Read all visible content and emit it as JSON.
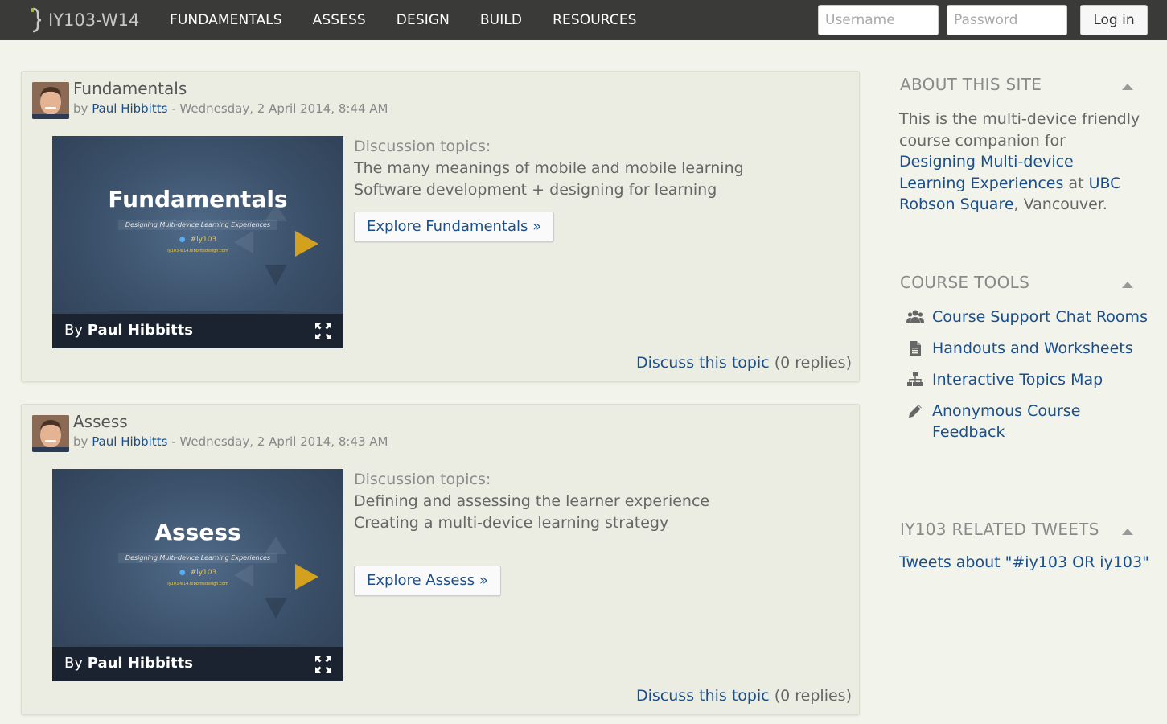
{
  "header": {
    "brand": "IY103-W14",
    "nav": [
      "FUNDAMENTALS",
      "ASSESS",
      "DESIGN",
      "BUILD",
      "RESOURCES"
    ],
    "username_placeholder": "Username",
    "password_placeholder": "Password",
    "login_label": "Log in"
  },
  "posts": [
    {
      "title": "Fundamentals",
      "by": "by",
      "author": "Paul Hibbitts",
      "date": " - Wednesday, 2 April 2014, 8:44 AM",
      "video": {
        "title": "Fundamentals",
        "subtitle": "Designing Multi-device Learning Experiences",
        "hashtag": "#iy103",
        "url": "iy103-w14.hibbittsdesign.com",
        "by_prefix": "By ",
        "by_name": "Paul Hibbitts"
      },
      "topics_label": "Discussion topics:",
      "topics": [
        "The many meanings of mobile and mobile learning",
        "Software development + designing for learning"
      ],
      "explore_label": "Explore Fundamentals »",
      "discuss_label": "Discuss this topic",
      "replies": " (0 replies)"
    },
    {
      "title": "Assess",
      "by": "by",
      "author": "Paul Hibbitts",
      "date": " - Wednesday, 2 April 2014, 8:43 AM",
      "video": {
        "title": "Assess",
        "subtitle": "Designing Multi-device Learning Experiences",
        "hashtag": "#iy103",
        "url": "iy103-w14.hibbittsdesign.com",
        "by_prefix": "By ",
        "by_name": "Paul Hibbitts"
      },
      "topics_label": "Discussion topics:",
      "topics": [
        "Defining and assessing the learner experience",
        "Creating a multi-device learning strategy"
      ],
      "explore_label": "Explore Assess »",
      "discuss_label": "Discuss this topic",
      "replies": " (0 replies)"
    }
  ],
  "sidebar": {
    "about": {
      "heading": "ABOUT THIS SITE",
      "text_1": "This is the multi-device friendly course companion for ",
      "link_1": "Designing Multi-device Learning Experiences",
      "text_2": " at ",
      "link_2": "UBC Robson Square",
      "text_3": ", Vancouver."
    },
    "tools": {
      "heading": "COURSE TOOLS",
      "items": [
        {
          "label": "Course Support Chat Rooms",
          "icon": "users-icon"
        },
        {
          "label": "Handouts and Worksheets",
          "icon": "document-icon"
        },
        {
          "label": "Interactive Topics Map",
          "icon": "sitemap-icon"
        },
        {
          "label": "Anonymous Course Feedback",
          "icon": "pencil-icon"
        }
      ]
    },
    "tweets": {
      "heading": "IY103 RELATED TWEETS",
      "link": "Tweets about \"#iy103 OR iy103\""
    }
  },
  "colors": {
    "header_bg": "#3a3a38",
    "page_bg": "#f2f3ea",
    "link": "#1a4f8b",
    "accent_play": "#d4a11e"
  }
}
